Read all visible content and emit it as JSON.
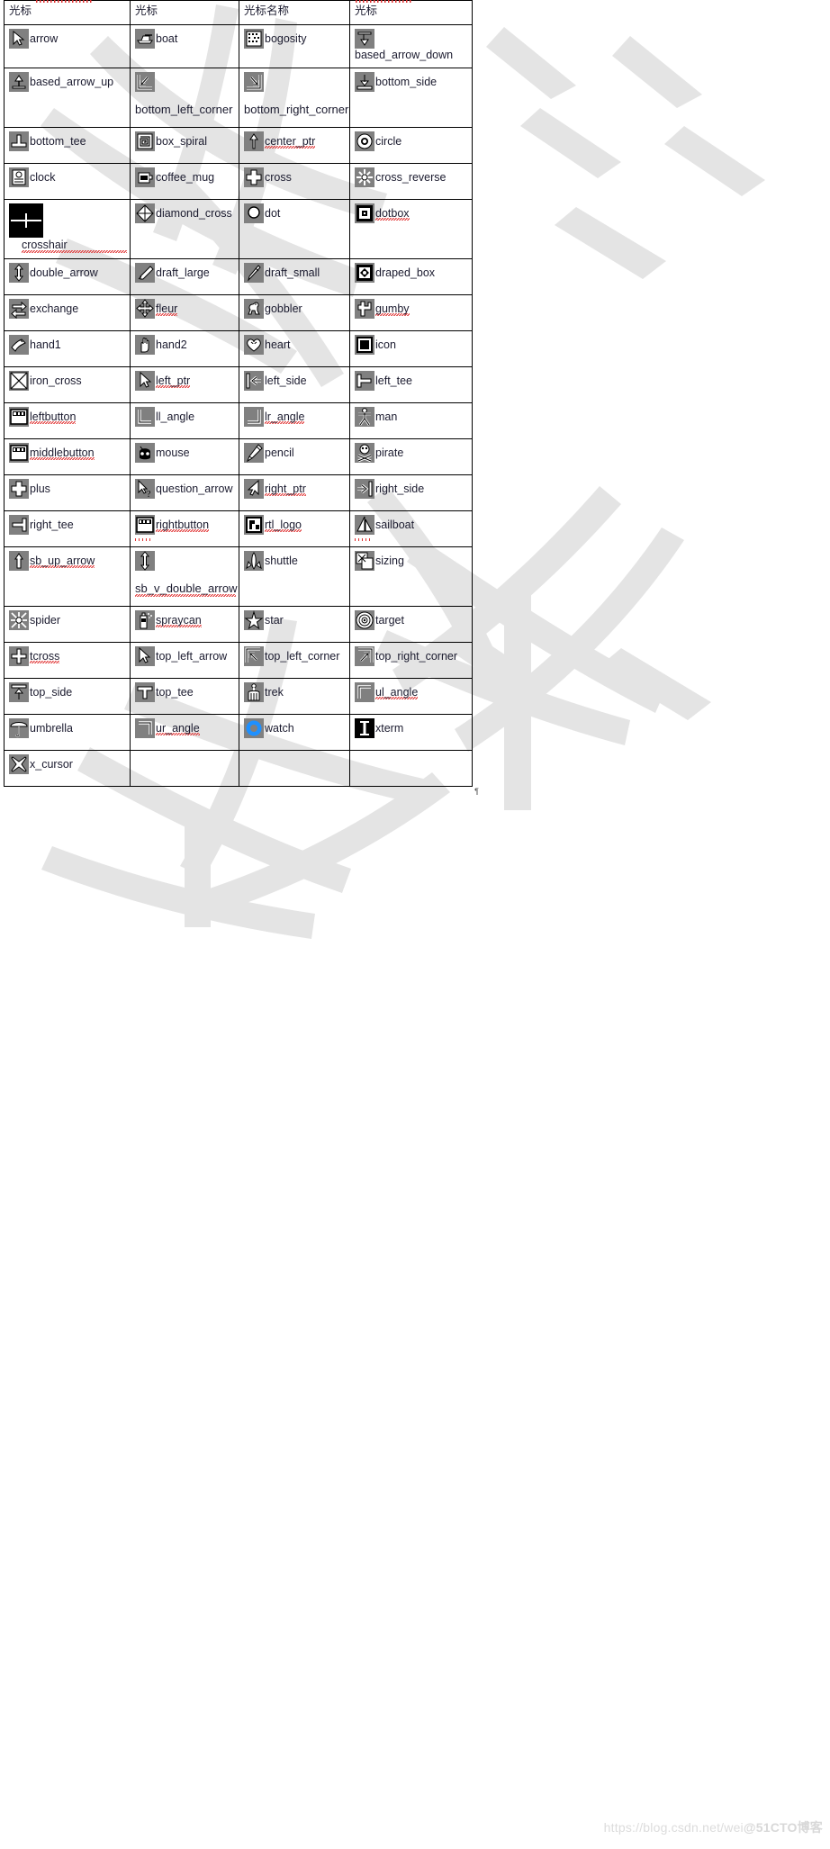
{
  "document": {
    "title": "X11 cursor font reference table",
    "footer_credit_url": "https://blog.csdn.net/wei",
    "footer_credit_brand": "@51CTO博客"
  },
  "table": {
    "headers": [
      "光标",
      "光标",
      "光标名称",
      "光标"
    ],
    "rows": [
      [
        {
          "icon": "arrow-icon",
          "label": "arrow",
          "layout": "inline"
        },
        {
          "icon": "boat-icon",
          "label": "boat",
          "layout": "inline"
        },
        {
          "icon": "bogosity-icon",
          "label": "bogosity",
          "layout": "inline"
        },
        {
          "icon": "based-arrow-down-icon",
          "label": "based_arrow_down",
          "layout": "inline"
        }
      ],
      [
        {
          "icon": "based-arrow-up-icon",
          "label": "based_arrow_up",
          "layout": "inline"
        },
        {
          "icon": "bottom-left-corner-icon",
          "label": "bottom_left_corner",
          "layout": "wrapped"
        },
        {
          "icon": "bottom-right-corner-icon",
          "label": "bottom_right_corner",
          "layout": "wrapped"
        },
        {
          "icon": "bottom-side-icon",
          "label": "bottom_side",
          "layout": "inline"
        }
      ],
      [
        {
          "icon": "bottom-tee-icon",
          "label": "bottom_tee",
          "layout": "inline"
        },
        {
          "icon": "box-spiral-icon",
          "label": "box_spiral",
          "layout": "inline"
        },
        {
          "icon": "center-ptr-icon",
          "label": "center_ptr",
          "layout": "inline",
          "spell": true
        },
        {
          "icon": "circle-icon",
          "label": "circle",
          "layout": "inline"
        }
      ],
      [
        {
          "icon": "clock-icon",
          "label": "clock",
          "layout": "inline"
        },
        {
          "icon": "coffee-mug-icon",
          "label": "coffee_mug",
          "layout": "inline"
        },
        {
          "icon": "cross-icon",
          "label": "cross",
          "layout": "inline"
        },
        {
          "icon": "cross-reverse-icon",
          "label": "cross_reverse",
          "layout": "inline"
        }
      ],
      [
        {
          "icon": "crosshair-icon",
          "label": "crosshair",
          "layout": "under",
          "spell": true,
          "big": true,
          "black": true
        },
        {
          "icon": "diamond-cross-icon",
          "label": "diamond_cross",
          "layout": "inline"
        },
        {
          "icon": "dot-icon",
          "label": "dot",
          "layout": "inline"
        },
        {
          "icon": "dotbox-icon",
          "label": "dotbox",
          "layout": "inline",
          "spell": true
        }
      ],
      [
        {
          "icon": "double-arrow-icon",
          "label": "double_arrow",
          "layout": "inline"
        },
        {
          "icon": "draft-large-icon",
          "label": "draft_large",
          "layout": "inline"
        },
        {
          "icon": "draft-small-icon",
          "label": "draft_small",
          "layout": "inline"
        },
        {
          "icon": "draped-box-icon",
          "label": "draped_box",
          "layout": "inline"
        }
      ],
      [
        {
          "icon": "exchange-icon",
          "label": "exchange",
          "layout": "inline"
        },
        {
          "icon": "fleur-icon",
          "label": "fleur",
          "layout": "inline",
          "spell": true
        },
        {
          "icon": "gobbler-icon",
          "label": "gobbler",
          "layout": "inline"
        },
        {
          "icon": "gumby-icon",
          "label": "gumby",
          "layout": "inline",
          "spell": true
        }
      ],
      [
        {
          "icon": "hand1-icon",
          "label": "hand1",
          "layout": "inline"
        },
        {
          "icon": "hand2-icon",
          "label": "hand2",
          "layout": "inline"
        },
        {
          "icon": "heart-icon",
          "label": "heart",
          "layout": "inline"
        },
        {
          "icon": "icon-icon",
          "label": "icon",
          "layout": "inline"
        }
      ],
      [
        {
          "icon": "iron-cross-icon",
          "label": "iron_cross",
          "layout": "inline"
        },
        {
          "icon": "left-ptr-icon",
          "label": "left_ptr",
          "layout": "inline",
          "spell": true
        },
        {
          "icon": "left-side-icon",
          "label": "left_side",
          "layout": "inline"
        },
        {
          "icon": "left-tee-icon",
          "label": "left_tee",
          "layout": "inline"
        }
      ],
      [
        {
          "icon": "leftbutton-icon",
          "label": "leftbutton",
          "layout": "inline",
          "spell": true
        },
        {
          "icon": "ll-angle-icon",
          "label": "ll_angle",
          "layout": "inline"
        },
        {
          "icon": "lr-angle-icon",
          "label": "lr_angle",
          "layout": "inline",
          "spell": true
        },
        {
          "icon": "man-icon",
          "label": "man",
          "layout": "inline"
        }
      ],
      [
        {
          "icon": "middlebutton-icon",
          "label": "middlebutton",
          "layout": "inline",
          "spell": true
        },
        {
          "icon": "mouse-icon",
          "label": "mouse",
          "layout": "inline"
        },
        {
          "icon": "pencil-icon",
          "label": "pencil",
          "layout": "inline"
        },
        {
          "icon": "pirate-icon",
          "label": "pirate",
          "layout": "inline"
        }
      ],
      [
        {
          "icon": "plus-icon",
          "label": "plus",
          "layout": "inline"
        },
        {
          "icon": "question-arrow-icon",
          "label": "question_arrow",
          "layout": "inline"
        },
        {
          "icon": "right-ptr-icon",
          "label": "right_ptr",
          "layout": "inline",
          "spell": true
        },
        {
          "icon": "right-side-icon",
          "label": "right_side",
          "layout": "inline"
        }
      ],
      [
        {
          "icon": "right-tee-icon",
          "label": "right_tee",
          "layout": "inline"
        },
        {
          "icon": "rightbutton-icon",
          "label": "rightbutton",
          "layout": "inline",
          "spell": true
        },
        {
          "icon": "rtl-logo-icon",
          "label": "rtl_logo",
          "layout": "inline",
          "spell": true
        },
        {
          "icon": "sailboat-icon",
          "label": "sailboat",
          "layout": "inline"
        }
      ],
      [
        {
          "icon": "sb-up-arrow-icon",
          "label": "sb_up_arrow",
          "layout": "inline",
          "spell": true
        },
        {
          "icon": "sb-v-double-arrow-icon",
          "label": "sb_v_double_arrow",
          "layout": "wrapped",
          "spell": true
        },
        {
          "icon": "shuttle-icon",
          "label": "shuttle",
          "layout": "inline"
        },
        {
          "icon": "sizing-icon",
          "label": "sizing",
          "layout": "inline"
        }
      ],
      [
        {
          "icon": "spider-icon",
          "label": "spider",
          "layout": "inline"
        },
        {
          "icon": "spraycan-icon",
          "label": "spraycan",
          "layout": "inline",
          "spell": true
        },
        {
          "icon": "star-icon",
          "label": "star",
          "layout": "inline"
        },
        {
          "icon": "target-icon",
          "label": "target",
          "layout": "inline"
        }
      ],
      [
        {
          "icon": "tcross-icon",
          "label": "tcross",
          "layout": "inline",
          "spell": true
        },
        {
          "icon": "top-left-arrow-icon",
          "label": "top_left_arrow",
          "layout": "inline"
        },
        {
          "icon": "top-left-corner-icon",
          "label": "top_left_corner",
          "layout": "inline"
        },
        {
          "icon": "top-right-corner-icon",
          "label": "top_right_corner",
          "layout": "inline"
        }
      ],
      [
        {
          "icon": "top-side-icon",
          "label": "top_side",
          "layout": "inline"
        },
        {
          "icon": "top-tee-icon",
          "label": "top_tee",
          "layout": "inline"
        },
        {
          "icon": "trek-icon",
          "label": "trek",
          "layout": "inline"
        },
        {
          "icon": "ul-angle-icon",
          "label": "ul_angle",
          "layout": "inline",
          "spell": true
        }
      ],
      [
        {
          "icon": "umbrella-icon",
          "label": "umbrella",
          "layout": "inline"
        },
        {
          "icon": "ur-angle-icon",
          "label": "ur_angle",
          "layout": "inline",
          "spell": true
        },
        {
          "icon": "watch-icon",
          "label": "watch",
          "layout": "inline"
        },
        {
          "icon": "xterm-icon",
          "label": "xterm",
          "layout": "inline",
          "black": true
        }
      ],
      [
        {
          "icon": "x-cursor-icon",
          "label": "x_cursor",
          "layout": "inline"
        },
        {
          "icon": "",
          "label": "",
          "layout": "empty"
        },
        {
          "icon": "",
          "label": "",
          "layout": "empty"
        },
        {
          "icon": "",
          "label": "",
          "layout": "empty"
        }
      ]
    ]
  },
  "colors": {
    "icon_background": "#808080",
    "icon_background_dark": "#000000",
    "text": "#1a1a2e",
    "border": "#000000",
    "spellcheck_underline": "#e03131",
    "watermark": "#e3e3e3"
  }
}
